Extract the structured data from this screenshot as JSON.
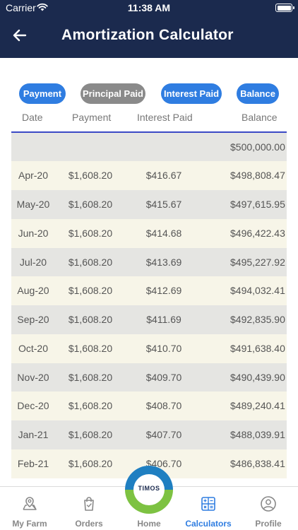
{
  "status_bar": {
    "carrier": "Carrier",
    "time": "11:38 AM"
  },
  "header": {
    "title": "Amortization Calculator"
  },
  "legend_pills": [
    {
      "label": "Payment",
      "color": "#2f7de1"
    },
    {
      "label": "Principal Paid",
      "color": "#8a8a8a"
    },
    {
      "label": "Interest Paid",
      "color": "#2f7de1"
    },
    {
      "label": "Balance",
      "color": "#2f7de1"
    }
  ],
  "table": {
    "columns": [
      "Date",
      "Payment",
      "Interest Paid",
      "Balance"
    ],
    "initial_balance": "$500,000.00",
    "rows": [
      {
        "date": "Apr-20",
        "payment": "$1,608.20",
        "interest": "$416.67",
        "balance": "$498,808.47"
      },
      {
        "date": "May-20",
        "payment": "$1,608.20",
        "interest": "$415.67",
        "balance": "$497,615.95"
      },
      {
        "date": "Jun-20",
        "payment": "$1,608.20",
        "interest": "$414.68",
        "balance": "$496,422.43"
      },
      {
        "date": "Jul-20",
        "payment": "$1,608.20",
        "interest": "$413.69",
        "balance": "$495,227.92"
      },
      {
        "date": "Aug-20",
        "payment": "$1,608.20",
        "interest": "$412.69",
        "balance": "$494,032.41"
      },
      {
        "date": "Sep-20",
        "payment": "$1,608.20",
        "interest": "$411.69",
        "balance": "$492,835.90"
      },
      {
        "date": "Oct-20",
        "payment": "$1,608.20",
        "interest": "$410.70",
        "balance": "$491,638.40"
      },
      {
        "date": "Nov-20",
        "payment": "$1,608.20",
        "interest": "$409.70",
        "balance": "$490,439.90"
      },
      {
        "date": "Dec-20",
        "payment": "$1,608.20",
        "interest": "$408.70",
        "balance": "$489,240.41"
      },
      {
        "date": "Jan-21",
        "payment": "$1,608.20",
        "interest": "$407.70",
        "balance": "$488,039.91"
      },
      {
        "date": "Feb-21",
        "payment": "$1,608.20",
        "interest": "$406.70",
        "balance": "$486,838.41"
      }
    ]
  },
  "tabbar": {
    "items": [
      {
        "label": "My Farm",
        "icon": "map-pin-icon"
      },
      {
        "label": "Orders",
        "icon": "shopping-bag-icon"
      },
      {
        "label": "Home",
        "icon": "home-logo"
      },
      {
        "label": "Calculators",
        "icon": "calculator-icon",
        "active": true
      },
      {
        "label": "Profile",
        "icon": "profile-icon"
      }
    ],
    "logo_text": "TIMOS",
    "active_color": "#2f7de1"
  },
  "colors": {
    "header_bg": "#1b2a4e",
    "row_grey": "#e5e5e2",
    "row_cream": "#f7f5e8",
    "accent": "#3b49c6"
  }
}
